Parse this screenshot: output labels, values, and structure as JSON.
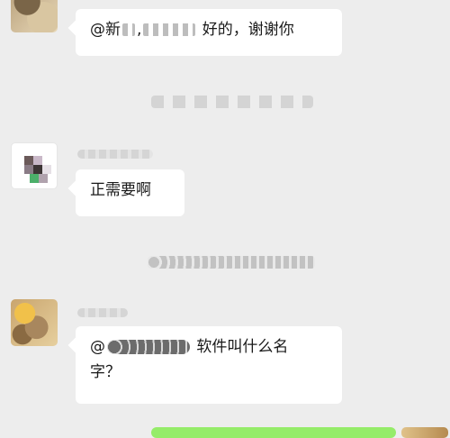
{
  "messages": [
    {
      "text_prefix": "@新",
      "text_suffix": " 好的，谢谢你"
    },
    {
      "text": "正需要啊"
    },
    {
      "text_prefix": "@",
      "text_suffix": " 软件叫什么名",
      "text_line2": "字？"
    }
  ],
  "colors": {
    "background": "#ededed",
    "incoming_bubble": "#ffffff",
    "outgoing_bubble": "#95ec69",
    "text": "#191919"
  },
  "icons": {
    "avatar": "user-avatar-image",
    "redaction": "mosaic-blur"
  }
}
